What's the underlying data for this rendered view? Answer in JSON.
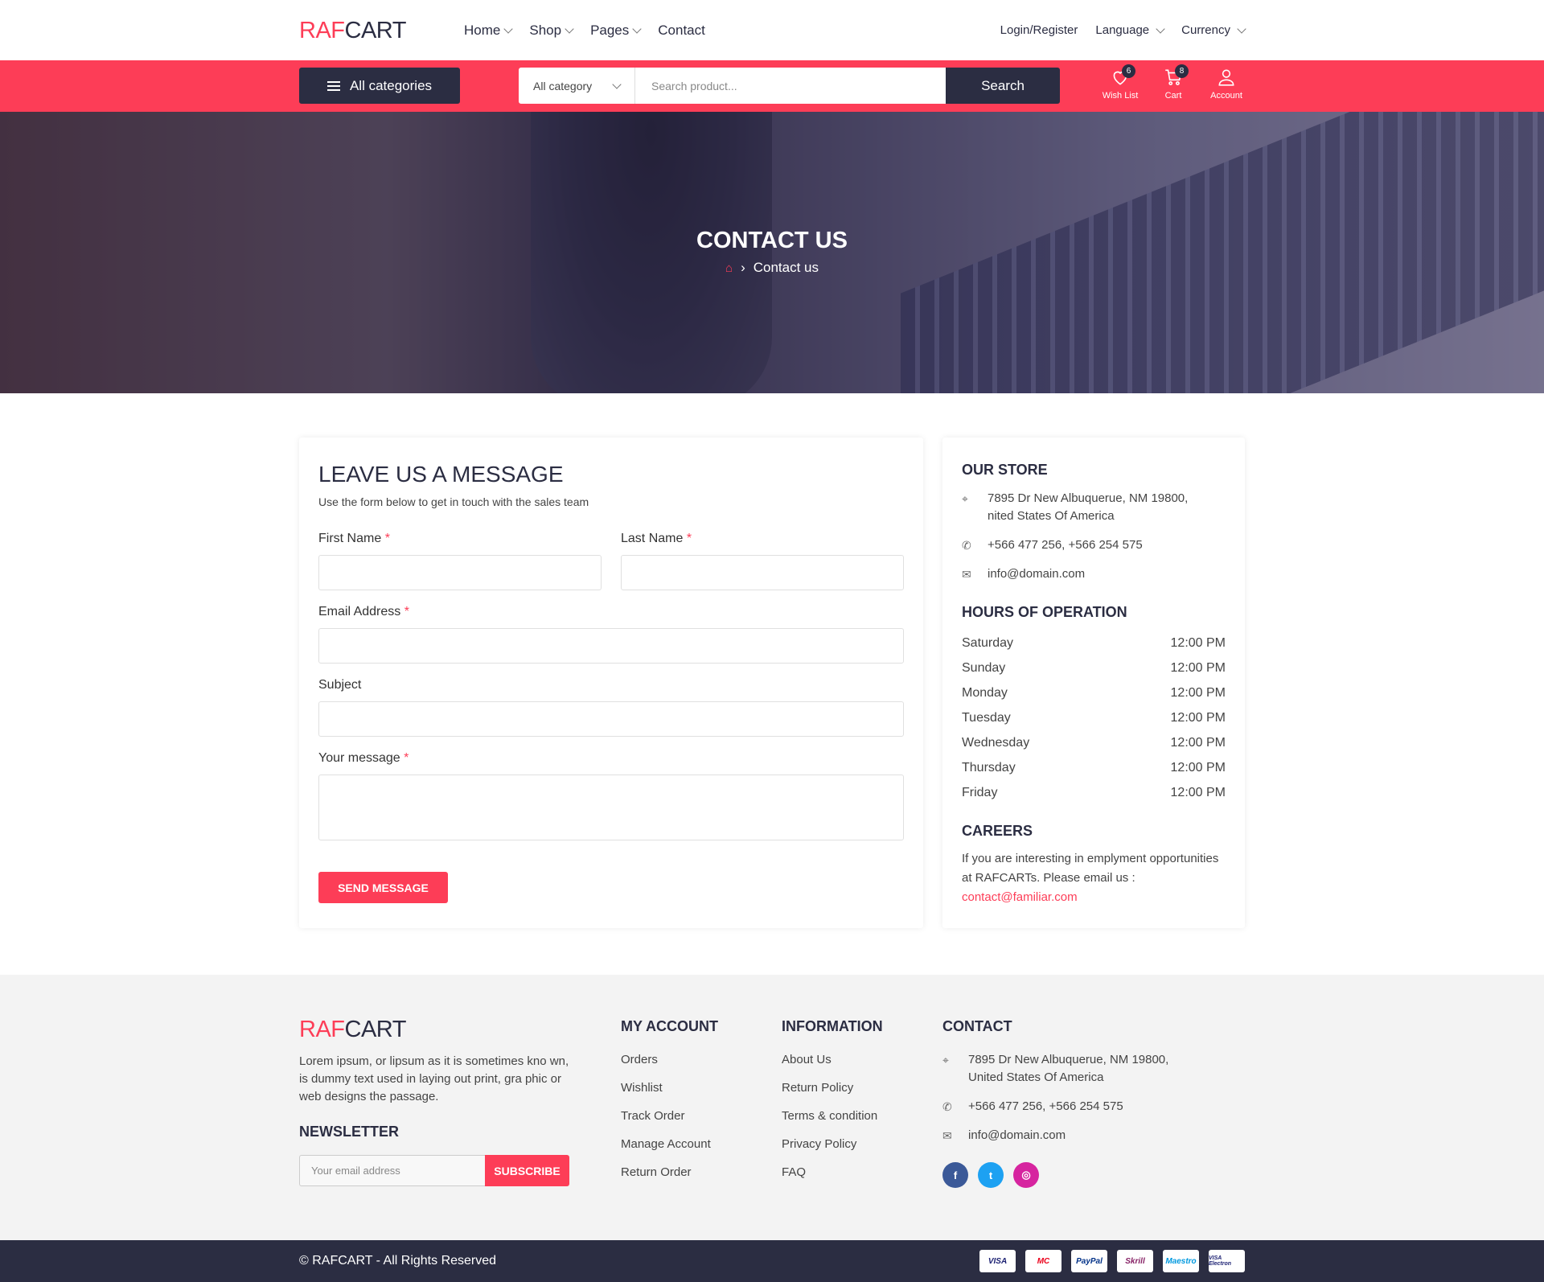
{
  "header": {
    "logo_a": "RAF",
    "logo_b": "CART",
    "nav": [
      "Home",
      "Shop",
      "Pages",
      "Contact"
    ],
    "login": "Login/Register",
    "language": "Language",
    "currency": "Currency"
  },
  "searchbar": {
    "all_categories": "All categories",
    "category_select": "All category",
    "placeholder": "Search product...",
    "search_button": "Search",
    "wishlist_label": "Wish List",
    "wishlist_count": "6",
    "cart_label": "Cart",
    "cart_count": "8",
    "account_label": "Account"
  },
  "hero": {
    "title": "CONTACT US",
    "breadcrumb": "Contact us"
  },
  "form": {
    "title": "LEAVE US A MESSAGE",
    "subtitle": "Use the form below to get in touch with the sales team",
    "first_name": "First Name",
    "last_name": "Last Name",
    "email": "Email Address",
    "subject": "Subject",
    "message": "Your message",
    "required_mark": "*",
    "send": "SEND MESSAGE"
  },
  "store": {
    "title": "OUR STORE",
    "address_line1": "7895 Dr New Albuquerue, NM 19800,",
    "address_line2": "nited States Of America",
    "phone": "+566 477 256, +566 254 575",
    "email": "info@domain.com",
    "hours_title": "HOURS OF OPERATION",
    "hours": [
      {
        "day": "Saturday",
        "time": "12:00 PM"
      },
      {
        "day": "Sunday",
        "time": "12:00 PM"
      },
      {
        "day": "Monday",
        "time": "12:00 PM"
      },
      {
        "day": "Tuesday",
        "time": "12:00 PM"
      },
      {
        "day": "Wednesday",
        "time": "12:00 PM"
      },
      {
        "day": "Thursday",
        "time": "12:00 PM"
      },
      {
        "day": "Friday",
        "time": "12:00 PM"
      }
    ],
    "careers_title": "CAREERS",
    "careers_text": "If you are interesting in emplyment opportunities at RAFCARTs. Please email us :",
    "careers_email": "contact@familiar.com"
  },
  "footer": {
    "logo_a": "RAF",
    "logo_b": "CART",
    "description": "Lorem ipsum, or lipsum as it is sometimes kno wn, is dummy text used in laying out print, gra phic or web designs the passage.",
    "newsletter_title": "NEWSLETTER",
    "newsletter_placeholder": "Your email address",
    "subscribe": "SUBSCRIBE",
    "my_account_title": "MY ACCOUNT",
    "my_account": [
      "Orders",
      "Wishlist",
      "Track Order",
      "Manage Account",
      "Return Order"
    ],
    "information_title": "INFORMATION",
    "information": [
      "About Us",
      "Return Policy",
      "Terms & condition",
      "Privacy Policy",
      "FAQ"
    ],
    "contact_title": "CONTACT",
    "contact_address_line1": "7895 Dr New Albuquerue, NM 19800,",
    "contact_address_line2": "United States Of America",
    "contact_phone": "+566 477 256, +566 254 575",
    "contact_email": "info@domain.com",
    "social": {
      "facebook": "f",
      "twitter": "t",
      "instagram": "◎"
    },
    "copyright": "© RAFCART - All Rights Reserved",
    "payments": [
      "VISA",
      "MC",
      "PayPal",
      "Skrill",
      "Maestro",
      "VISA Electron"
    ]
  },
  "colors": {
    "accent": "#fd3d57",
    "dark": "#2b2d42",
    "facebook": "#3b5998",
    "twitter": "#1da1f2",
    "instagram": "#d6249f"
  }
}
